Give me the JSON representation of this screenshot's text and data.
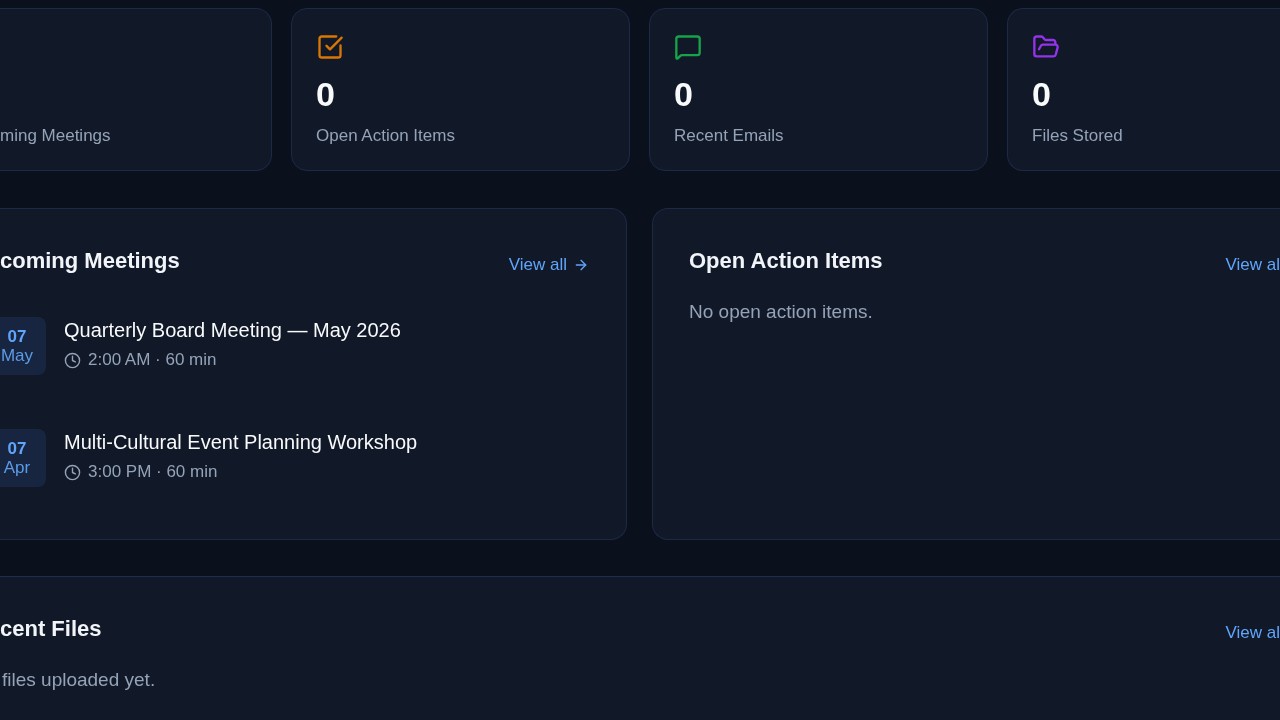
{
  "stats": [
    {
      "label": "ming Meetings"
    },
    {
      "kind": "tasks",
      "color": "#d97706",
      "value": "0",
      "label": "Open Action Items"
    },
    {
      "kind": "emails",
      "color": "#16a34a",
      "value": "0",
      "label": "Recent Emails"
    },
    {
      "kind": "files",
      "color": "#9333ea",
      "value": "0",
      "label": "Files Stored"
    }
  ],
  "meetings_panel": {
    "title": "coming Meetings",
    "link": {
      "label": "View all",
      "arrow": true
    },
    "meetings": [
      {
        "day": "07",
        "month": "May",
        "title": "Quarterly Board Meeting — May 2026",
        "meta": "2:00 AM · 60 min"
      },
      {
        "day": "07",
        "month": "Apr",
        "title": "Multi-Cultural Event Planning Workshop",
        "meta": "3:00 PM · 60 min"
      }
    ]
  },
  "action_items_panel": {
    "title": "Open Action Items",
    "link": {
      "label": "View al",
      "arrow": false
    },
    "empty_text": "No open action items."
  },
  "files_panel": {
    "title": "cent Files",
    "link": {
      "label": "View al",
      "arrow": false
    },
    "empty_text": "files uploaded yet."
  }
}
